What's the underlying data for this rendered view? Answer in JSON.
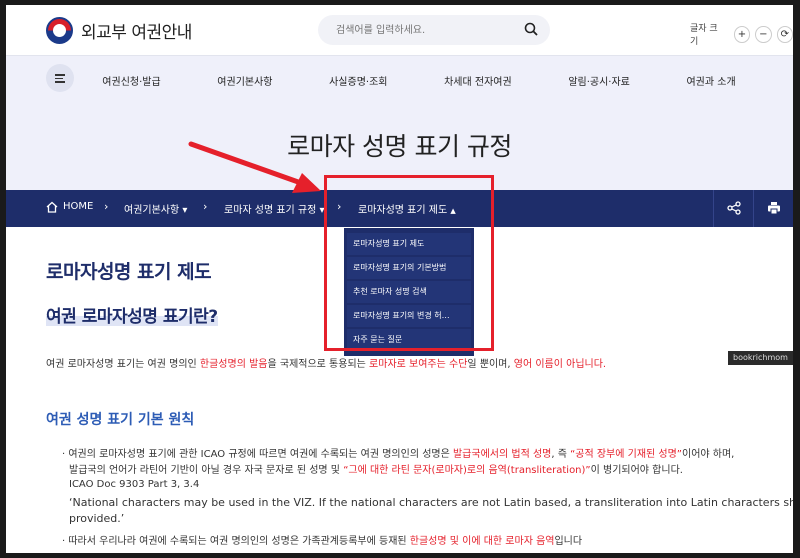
{
  "header": {
    "logo_text": "외교부 여권안내",
    "search_placeholder": "검색어를 입력하세요.",
    "fontsize_label": "글자 크기",
    "fontsize_buttons": [
      "+",
      "−",
      "⟳"
    ]
  },
  "nav": {
    "items": [
      "여권신청·발급",
      "여권기본사항",
      "사실증명·조회",
      "차세대 전자여권",
      "알림·공시·자료",
      "여권과 소개"
    ]
  },
  "page_title": "로마자 성명 표기 규정",
  "breadcrumb": {
    "home": "HOME",
    "level1": "여권기본사항",
    "level2": "로마자 성명 표기 규정",
    "level3": "로마자성명 표기 제도",
    "dropdown_arrow_level1": "▾",
    "dropdown_arrow_level3": "▲"
  },
  "dropdown": {
    "items": [
      "로마자성명 표기 제도",
      "로마자성명 표기의 기본방법",
      "추천 로마자 성명 검색",
      "로마자성명 표기의 변경 허…",
      "자주 묻는 질문"
    ]
  },
  "content": {
    "heading": "로마자성명 표기 제도",
    "subheading": "여권 로마자성명 표기란?",
    "para_1": "여권 로마자성명 표기는 여권 명의인",
    "para_red_1": "한글성명의 발음",
    "para_2": "을 국제적으로 통용되는",
    "para_red_2": "로마자로 보여주는 수단",
    "para_3": "일 뿐이며,",
    "para_red_3": "영어 이름이 아닙니다.",
    "watermark": "bookrichmom",
    "section_title": "여권 성명 표기 기본 원칙",
    "b1_a": "여권의 로마자성명 표기에 관한 ICAO 규정에 따르면 여권에 수록되는 여권 명의인의 성명은",
    "b1_red_a": "발급국에서의 법적 성명",
    "b1_b": ", 즉",
    "b1_red_b": "“공적 장부에 기재된 성명”",
    "b1_c": "이어야 하며,",
    "b1_line2_a": "발급국의 언어가 라틴어 기반이 아닐 경우 자국 문자로 된 성명 및",
    "b1_line2_red": "“그에 대한 라틴 문자(로마자)로의 음역(transliteration)”",
    "b1_line2_b": "이 병기되어야 합니다.",
    "icao_ref": "ICAO Doc 9303 Part 3, 3.4",
    "quote_1": "‘National characters may be used in the VIZ. If the national characters are not Latin based, a transliteration into Latin characters shall be",
    "quote_2": "provided.’",
    "b2_a": "따라서 우리나라 여권에 수록되는 여권 명의인의 성명은 가족관계등록부에 등재된",
    "b2_red": "한글성명 및 이에 대한 로마자 음역",
    "b2_b": "입니다"
  },
  "colors": {
    "navy": "#1e2d6a",
    "accent_red": "#e5202b",
    "section_blue": "#2d5cb5",
    "nav_bg": "#eff0fa"
  }
}
